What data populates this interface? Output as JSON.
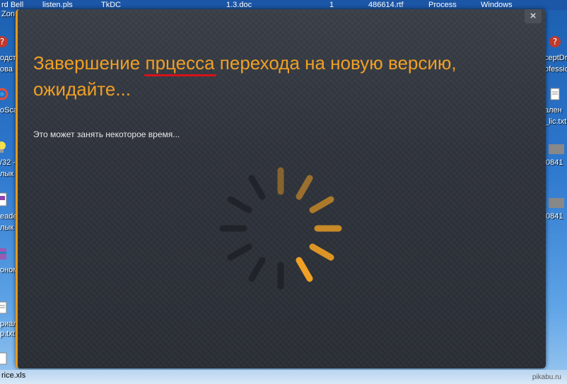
{
  "desktop": {
    "top_items": [
      "rd Bell",
      "listen.pls",
      "TkDC",
      "1.3.doc",
      "1",
      "486614.rtf",
      "Process",
      "Windows"
    ],
    "zone_label": "Zon",
    "left_labels": [
      "одст",
      "ова",
      "oScap",
      "/32 -",
      "лык",
      "eade",
      "лык",
      "оном",
      "риал",
      "р.txt"
    ],
    "right_labels": [
      "ceptDr",
      "ofessio",
      "ален",
      "_lic.txt",
      "0841",
      "0841"
    ],
    "bottom_file": "rice.xls"
  },
  "dialog": {
    "title_part1": "Завершение ",
    "title_underlined": "прцесса",
    "title_part2": " перехода на новую версию, ожидайте...",
    "subtitle": "Это может занять некоторое время...",
    "close_label": "×",
    "accent_color": "#f0a024",
    "spinner_progress": 0.5
  },
  "watermark": "pikabu.ru"
}
